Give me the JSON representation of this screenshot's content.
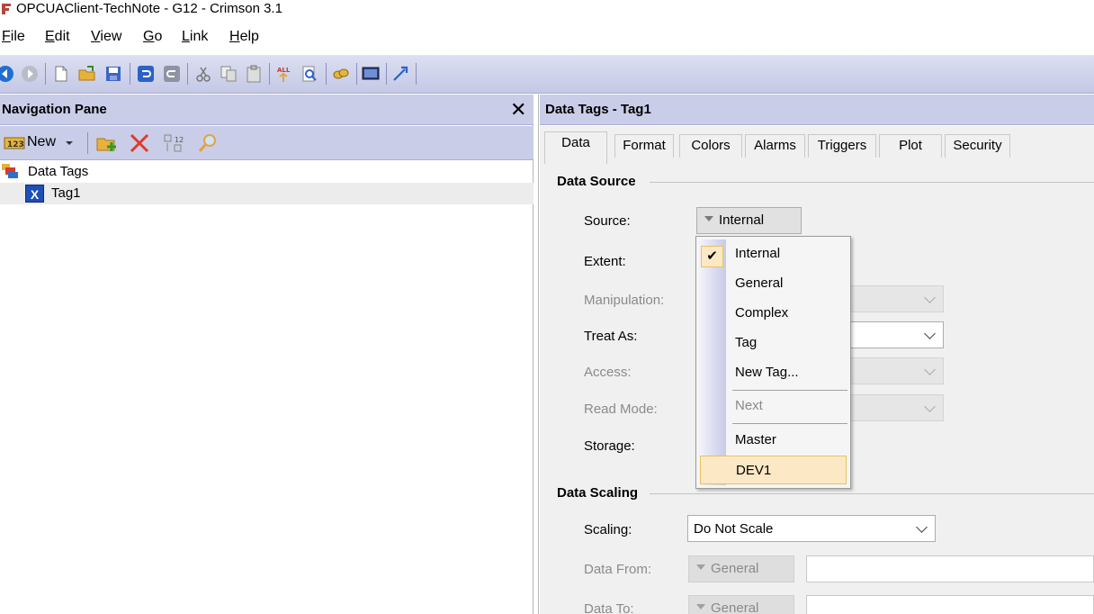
{
  "window": {
    "title": "OPCUAClient-TechNote - G12 - Crimson 3.1"
  },
  "menu": [
    {
      "label": "File",
      "underline": "F",
      "rest": "ile"
    },
    {
      "label": "Edit",
      "underline": "E",
      "rest": "dit"
    },
    {
      "label": "View",
      "underline": "V",
      "rest": "iew"
    },
    {
      "label": "Go",
      "underline": "G",
      "rest": "o"
    },
    {
      "label": "Link",
      "underline": "L",
      "rest": "ink"
    },
    {
      "label": "Help",
      "underline": "H",
      "rest": "elp"
    }
  ],
  "toolbar_icons": [
    "back-icon",
    "forward-icon",
    "new-file-icon",
    "open-folder-icon",
    "save-icon",
    "undo-icon",
    "redo-icon",
    "cut-icon",
    "copy-icon",
    "paste-icon",
    "find-icon",
    "search-replace-icon",
    "link-icon",
    "monitor-icon",
    "send-icon"
  ],
  "navigation": {
    "title": "Navigation Pane",
    "close_glyph": "✕",
    "new_label": "New",
    "tree": [
      {
        "label": "Data Tags",
        "icon": "data-tags-icon"
      },
      {
        "label": "Tag1",
        "icon": "tag-icon",
        "icon_glyph": "X",
        "selected": true
      }
    ]
  },
  "editor": {
    "title": "Data Tags - Tag1",
    "tabs": [
      {
        "label": "Data",
        "active": true
      },
      {
        "label": "Format"
      },
      {
        "label": "Colors"
      },
      {
        "label": "Alarms"
      },
      {
        "label": "Triggers"
      },
      {
        "label": "Plot"
      },
      {
        "label": "Security"
      }
    ],
    "data_source": {
      "title": "Data Source",
      "source_label": "Source:",
      "source_value": "Internal",
      "extent_label": "Extent:",
      "manipulation_label": "Manipulation:",
      "treat_as_label": "Treat As:",
      "access_label": "Access:",
      "read_mode_label": "Read Mode:",
      "storage_label": "Storage:"
    },
    "data_scaling": {
      "title": "Data Scaling",
      "scaling_label": "Scaling:",
      "scaling_value": "Do Not Scale",
      "data_from_label": "Data From:",
      "data_from_value": "General",
      "data_to_label": "Data To:",
      "data_to_value": "General"
    }
  },
  "source_menu": {
    "check_glyph": "✔",
    "items": [
      {
        "label": "Internal",
        "checked": true
      },
      {
        "label": "General"
      },
      {
        "label": "Complex"
      },
      {
        "label": "Tag"
      },
      {
        "label": "New Tag..."
      },
      {
        "label": "Next",
        "disabled": true
      },
      {
        "label": "Master"
      },
      {
        "label": "DEV1",
        "hover": true
      }
    ]
  }
}
